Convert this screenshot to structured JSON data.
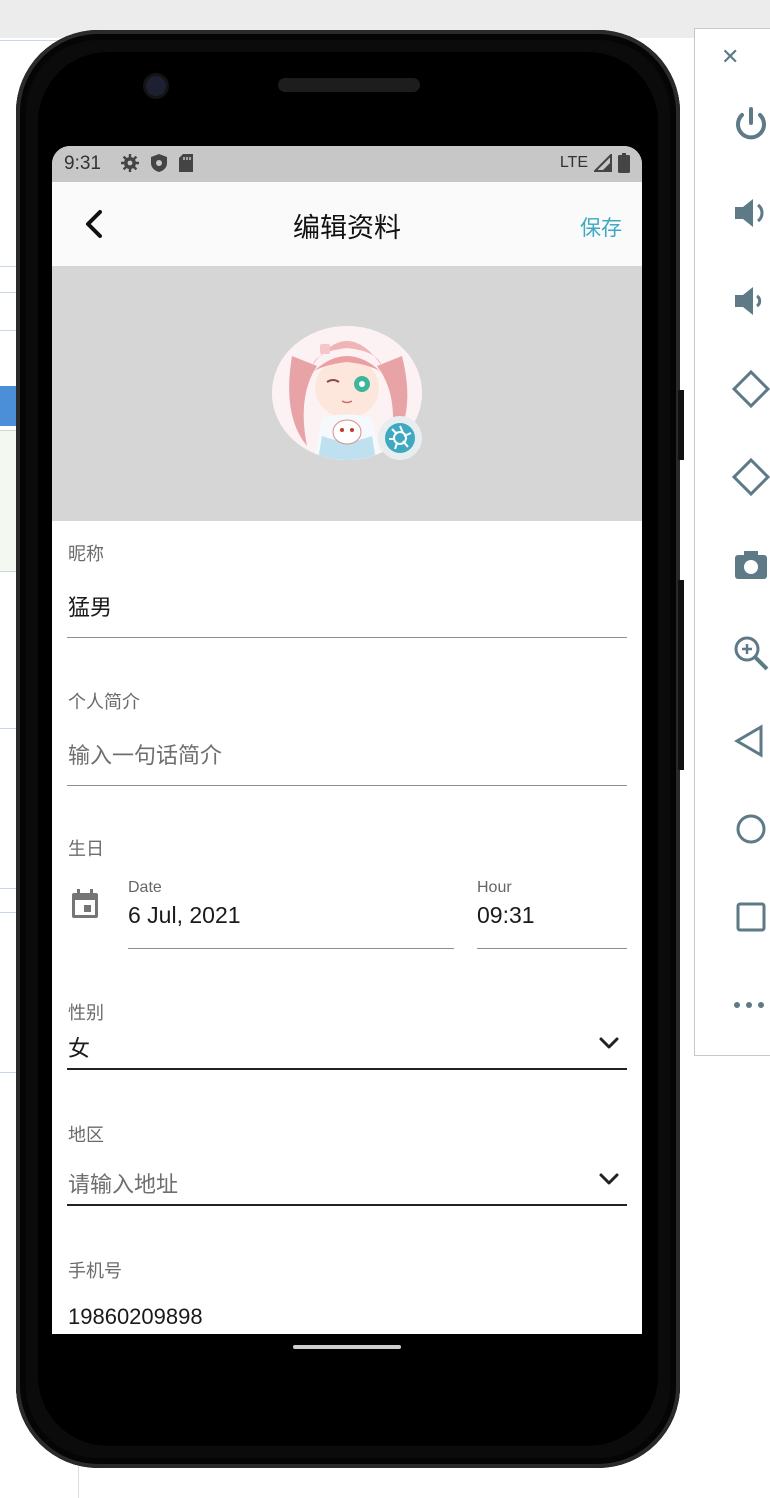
{
  "status": {
    "time": "9:31",
    "network": "LTE"
  },
  "appbar": {
    "title": "编辑资料",
    "save": "保存"
  },
  "form": {
    "nickname": {
      "label": "昵称",
      "value": "猛男"
    },
    "bio": {
      "label": "个人简介",
      "placeholder": "输入一句话简介"
    },
    "birthday": {
      "label": "生日",
      "date_label": "Date",
      "date_value": "6 Jul, 2021",
      "hour_label": "Hour",
      "hour_value": "09:31"
    },
    "gender": {
      "label": "性别",
      "value": "女"
    },
    "region": {
      "label": "地区",
      "placeholder": "请输入地址"
    },
    "phone": {
      "label": "手机号",
      "value": "19860209898"
    }
  },
  "icons": {
    "back": "chevron-left-icon",
    "camera_badge": "camera-shutter-icon",
    "calendar": "calendar-icon",
    "dropdown": "chevron-down-icon"
  },
  "colors": {
    "accent": "#3fa9c2",
    "statusbar": "#c7c7c7",
    "avatar_bg": "#d6d6d6"
  },
  "toolbar": {
    "items": [
      "close-icon",
      "power-icon",
      "volume-up-icon",
      "volume-down-icon",
      "rotate-left-icon",
      "rotate-right-icon",
      "camera-icon",
      "zoom-icon",
      "back-triangle-icon",
      "home-circle-icon",
      "overview-square-icon",
      "more-icon"
    ]
  }
}
